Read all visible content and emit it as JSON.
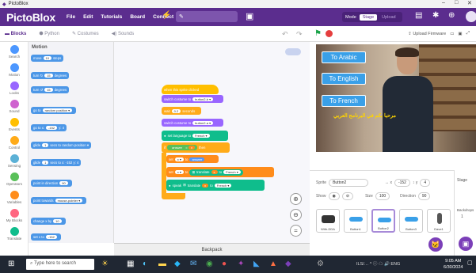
{
  "window": {
    "title": "PictoBlox",
    "controls": [
      "–",
      "□",
      "✕"
    ]
  },
  "menubar": {
    "logo": "PictoBlox",
    "menu": [
      "File",
      "Edit",
      "Tutorials",
      "Board",
      "Connect"
    ],
    "project_name": "",
    "mode_label": "Mode",
    "stage_label": "Stage",
    "upload_label": "Upload"
  },
  "tabs": {
    "blocks": "Blocks",
    "python": "Python",
    "costumes": "Costumes",
    "sounds": "Sounds"
  },
  "stage_toolbar": {
    "upload_firmware": "Upload Firmware"
  },
  "categories": [
    "Search",
    "Motion",
    "Looks",
    "Sound",
    "Events",
    "Control",
    "Sensing",
    "Operators",
    "Variables",
    "My Blocks",
    "Translate"
  ],
  "category_colors": [
    "#4c97ff",
    "#4c97ff",
    "#9966ff",
    "#cf63cf",
    "#ffbf00",
    "#ffab19",
    "#5cb1d6",
    "#59c059",
    "#ff8c1a",
    "#ff6680",
    "#0fbd8c"
  ],
  "palette": {
    "title": "Motion",
    "blocks": [
      {
        "text": "move",
        "input": "10",
        "suffix": "steps"
      },
      {
        "text": "turn ↻",
        "input": "15",
        "suffix": "degrees"
      },
      {
        "text": "turn ↺",
        "input": "15",
        "suffix": "degrees"
      },
      {
        "text": "go to",
        "input": "random position ▾",
        "suffix": ""
      },
      {
        "text": "go to x:",
        "input": "-152",
        "suffix": "y: 4"
      },
      {
        "text": "glide",
        "input": "1",
        "suffix": "secs to random position ▾"
      },
      {
        "text": "glide",
        "input": "1",
        "suffix": "secs to x: -152 y: 4"
      },
      {
        "text": "point in direction",
        "input": "90",
        "suffix": ""
      },
      {
        "text": "point towards",
        "input": "mouse-pointer ▾",
        "suffix": ""
      },
      {
        "text": "change x by",
        "input": "10",
        "suffix": ""
      },
      {
        "text": "set x to",
        "input": "-152",
        "suffix": ""
      }
    ]
  },
  "script": {
    "hat": "when this sprite clicked",
    "b1": "switch costume to",
    "b1_in": "button2-b ▾",
    "b2": "wait",
    "b2_in": "0.2",
    "b2_suffix": "seconds",
    "b3": "switch costume to",
    "b3_in": "button2-a ▾",
    "b4": "set language to",
    "b4_in": "French ▾",
    "b5": "if",
    "b5_in1": "answer",
    "b5_op": "=",
    "b5_in2": "x",
    "b5_suffix": "then",
    "b6": "set",
    "b6_in1": "x ▾",
    "b6_to": "to",
    "b6_in2": "answer",
    "b7": "set",
    "b7_in1": "x ▾",
    "b7_to": "to",
    "b7_mid": "translate",
    "b7_in2": "x",
    "b7_suffix": "to",
    "b7_in3": "French ▾",
    "b8": "speak",
    "b8_mid": "translate",
    "b8_in": "x",
    "b8_suffix": "to",
    "b8_in2": "French ▾"
  },
  "backpack": "Backpack",
  "stage": {
    "buttons": [
      "To Arabic",
      "To English",
      "To French"
    ],
    "subtitle": "مرحبا بكم في البرنامج العربي"
  },
  "sprite_info": {
    "sprite_label": "Sprite",
    "sprite_name": "Button2",
    "x_label": "↔ x",
    "x": "-152",
    "y_label": "↕ y",
    "y": "4",
    "show_label": "Show",
    "size_label": "Size",
    "size": "100",
    "direction_label": "Direction",
    "direction": "90"
  },
  "sprites": [
    "With-DDA",
    "Button1",
    "Button2",
    "Button3",
    "Dave1"
  ],
  "stage_col": {
    "label": "Stage",
    "backdrops_label": "Backdrops",
    "backdrops_count": "1"
  },
  "taskbar": {
    "search_placeholder": "Type here to search",
    "tray": "ILS/…  ^ ⓘ ☁ 🔊 ENG",
    "time": "9:05 AM",
    "date": "6/30/2024"
  }
}
